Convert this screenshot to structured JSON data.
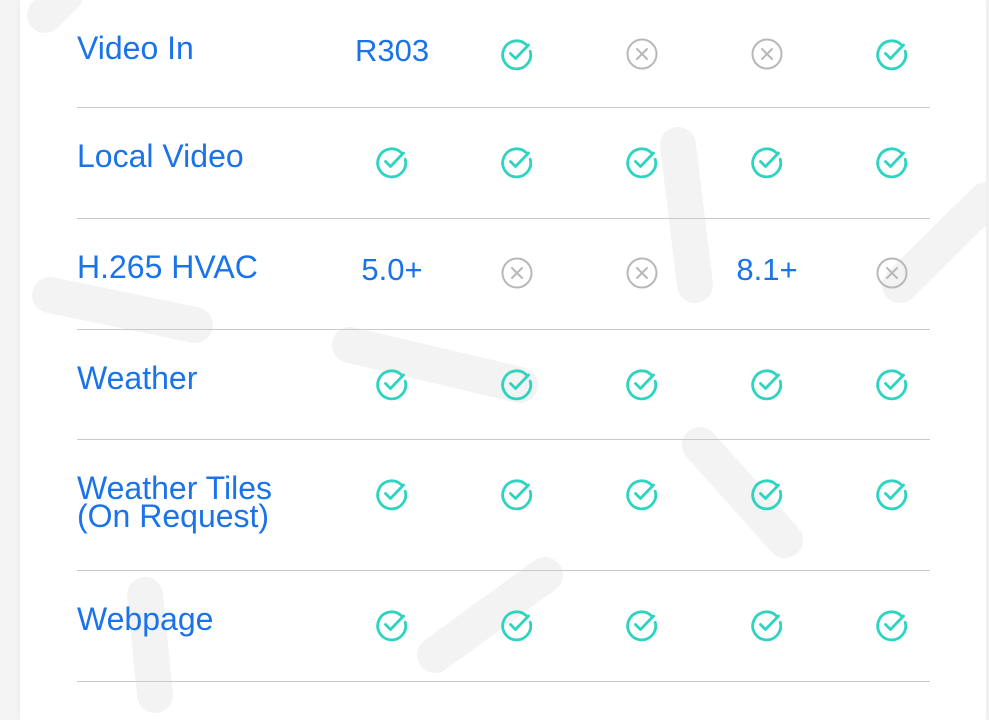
{
  "colors": {
    "accent": "#1a73e8",
    "check": "#2dd4bf",
    "cross": "#b8b8b8",
    "divider": "#c9c9c9"
  },
  "rows": [
    {
      "feature": "Video In",
      "cells": [
        {
          "type": "text",
          "value": "R303"
        },
        {
          "type": "check"
        },
        {
          "type": "cross"
        },
        {
          "type": "cross"
        },
        {
          "type": "check"
        }
      ]
    },
    {
      "feature": "Local Video",
      "cells": [
        {
          "type": "check"
        },
        {
          "type": "check"
        },
        {
          "type": "check"
        },
        {
          "type": "check"
        },
        {
          "type": "check"
        }
      ]
    },
    {
      "feature": "H.265 HVAC",
      "cells": [
        {
          "type": "text",
          "value": "5.0+"
        },
        {
          "type": "cross"
        },
        {
          "type": "cross"
        },
        {
          "type": "text",
          "value": "8.1+"
        },
        {
          "type": "cross"
        }
      ]
    },
    {
      "feature": "Weather",
      "cells": [
        {
          "type": "check"
        },
        {
          "type": "check"
        },
        {
          "type": "check"
        },
        {
          "type": "check"
        },
        {
          "type": "check"
        }
      ]
    },
    {
      "feature": "Weather Tiles (On Request)",
      "cells": [
        {
          "type": "check"
        },
        {
          "type": "check"
        },
        {
          "type": "check"
        },
        {
          "type": "check"
        },
        {
          "type": "check"
        }
      ]
    },
    {
      "feature": "Webpage",
      "cells": [
        {
          "type": "check"
        },
        {
          "type": "check"
        },
        {
          "type": "check"
        },
        {
          "type": "check"
        },
        {
          "type": "check"
        }
      ]
    }
  ]
}
